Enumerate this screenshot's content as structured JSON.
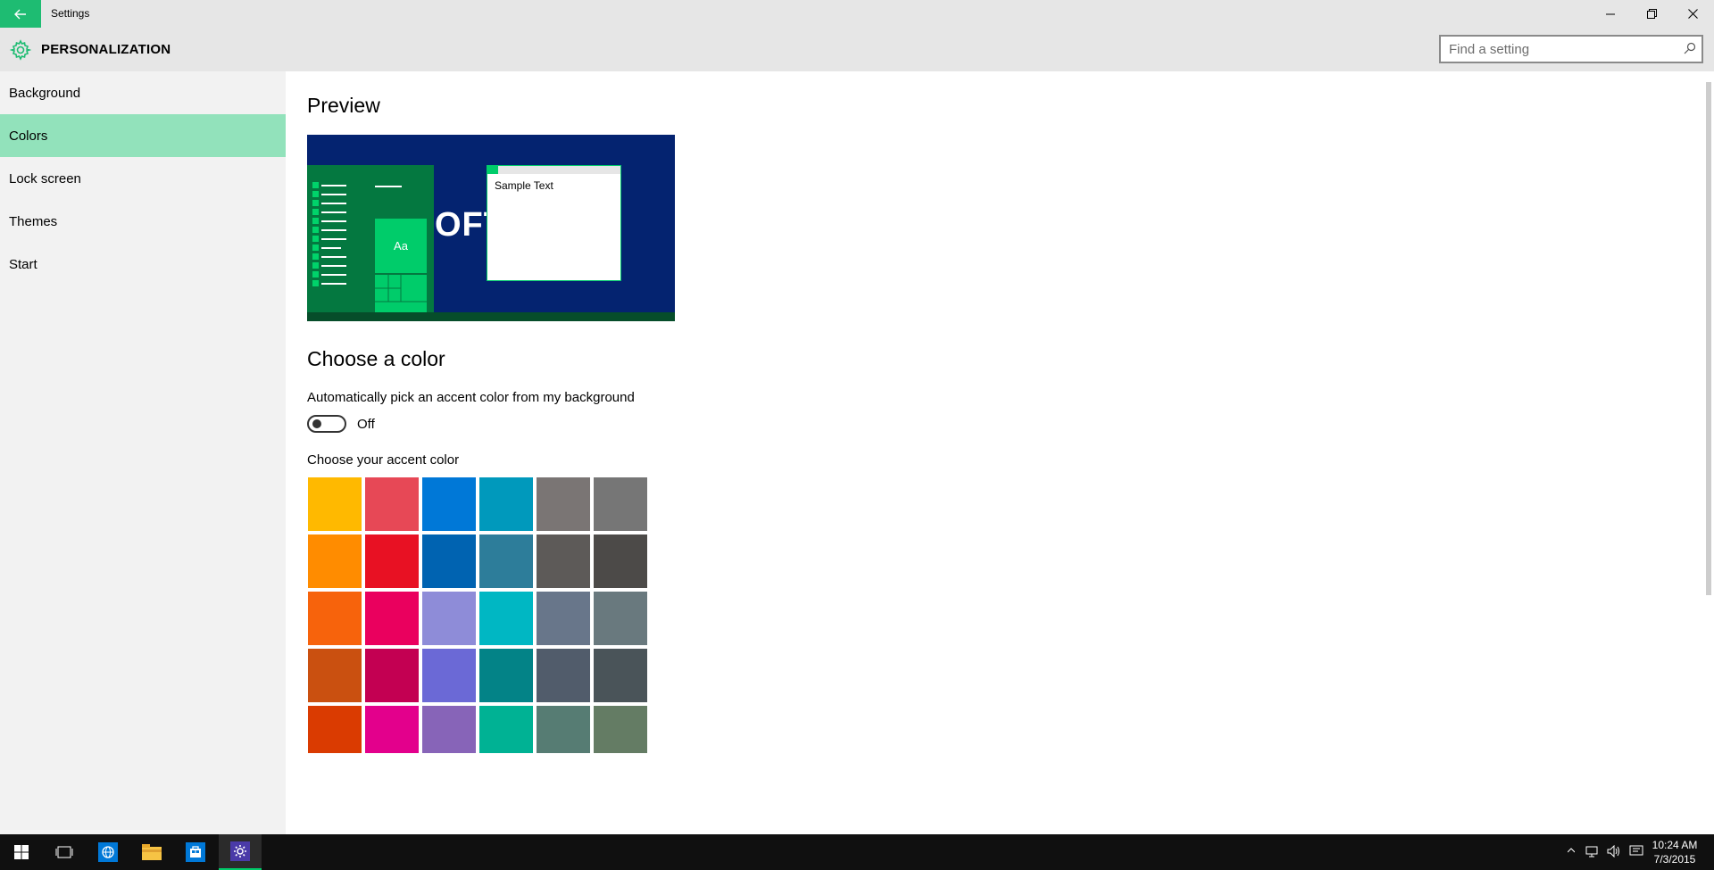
{
  "window": {
    "title": "Settings"
  },
  "header": {
    "title": "PERSONALIZATION",
    "search_placeholder": "Find a setting"
  },
  "sidebar": {
    "items": [
      {
        "label": "Background",
        "active": false
      },
      {
        "label": "Colors",
        "active": true
      },
      {
        "label": "Lock screen",
        "active": false
      },
      {
        "label": "Themes",
        "active": false
      },
      {
        "label": "Start",
        "active": false
      }
    ]
  },
  "main": {
    "preview_heading": "Preview",
    "preview": {
      "sample_text": "Sample Text",
      "tile_text": "Aa",
      "wallpaper_text": "OFT"
    },
    "choose_color_heading": "Choose a color",
    "auto_pick_label": "Automatically pick an accent color from my background",
    "auto_pick_state": "Off",
    "accent_label": "Choose your accent color",
    "selected_accent": "#00cc6a",
    "accent_colors": [
      [
        "#ffb900",
        "#e74856",
        "#0078d7",
        "#0099bc",
        "#7a7574",
        "#767676"
      ],
      [
        "#ff8c00",
        "#e81123",
        "#0063b1",
        "#2d7d9a",
        "#5d5a58",
        "#4c4a48"
      ],
      [
        "#f7630c",
        "#ea005e",
        "#8e8cd8",
        "#00b7c3",
        "#68768a",
        "#69797e"
      ],
      [
        "#ca5010",
        "#c30052",
        "#6b69d6",
        "#038387",
        "#515c6b",
        "#4a5459"
      ],
      [
        "#da3b01",
        "#e3008c",
        "#8764b8",
        "#00b294",
        "#567c73",
        "#647c64"
      ],
      [
        "#ef6950",
        "#bf0077",
        "#744da9",
        "#018574",
        "#486860",
        "#525e54"
      ],
      [
        "#d13438",
        "#c239b3",
        "#b146c2",
        "#00cc6a",
        "#498205",
        "#847545"
      ]
    ]
  },
  "taskbar": {
    "time": "10:24 AM",
    "date": "7/3/2015"
  },
  "colors": {
    "accent": "#00cc6a",
    "title_bar": "#e6e6e6",
    "sidebar": "#f2f2f2",
    "active_nav": "#92e2bb",
    "back_button": "#1ebc72",
    "taskbar": "#101010"
  }
}
